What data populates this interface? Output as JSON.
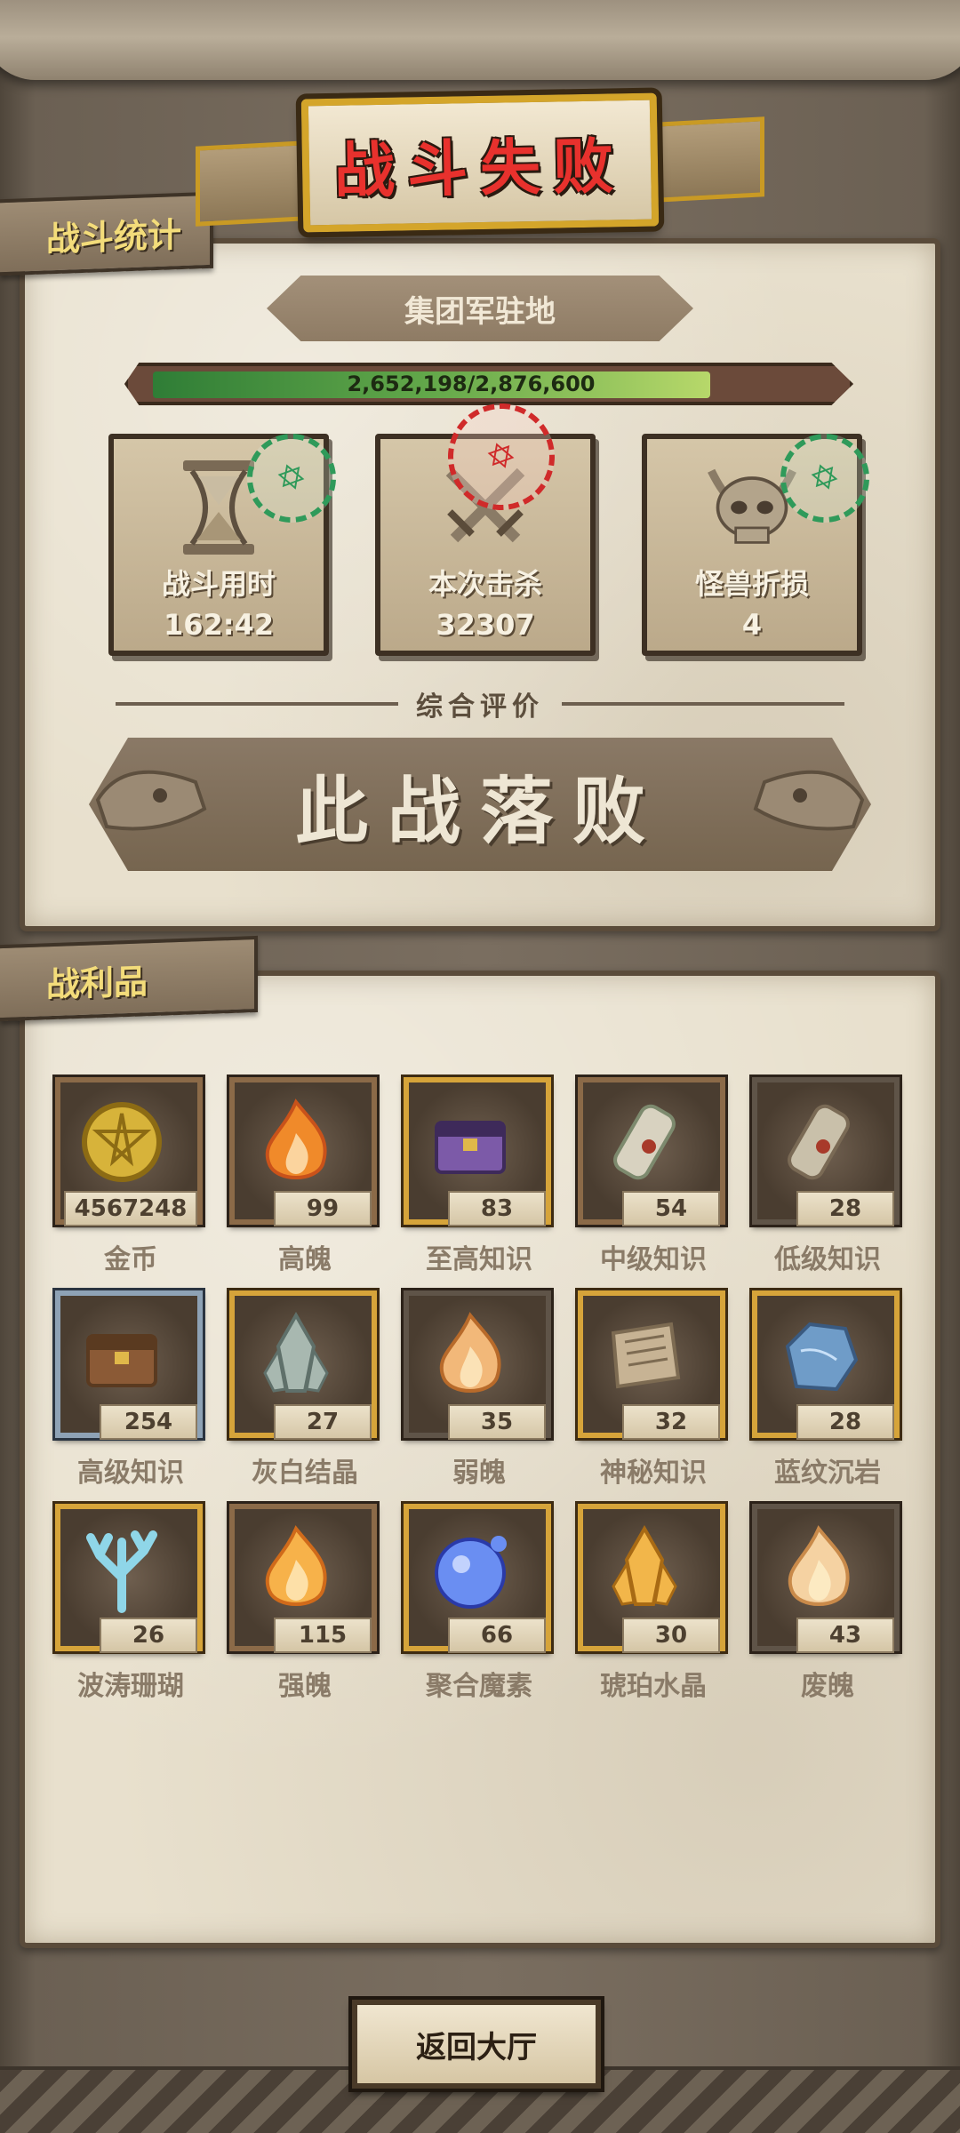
{
  "header": {
    "title": "战斗失败",
    "stats_tab": "战斗统计",
    "location": "集团军驻地"
  },
  "progress": {
    "current": 2652198,
    "max": 2876600,
    "text": "2,652,198/2,876,600",
    "fraction": 0.922
  },
  "stats": [
    {
      "label": "战斗用时",
      "value": "162:42",
      "icon": "hourglass-icon",
      "stamp": "hexagram-stamp",
      "stamp_color": "#2f9a5a"
    },
    {
      "label": "本次击杀",
      "value": "32307",
      "icon": "crossed-swords-icon",
      "stamp": "hexagram-stamp",
      "stamp_color": "#d02a2a"
    },
    {
      "label": "怪兽折损",
      "value": "4",
      "icon": "horned-skull-icon",
      "stamp": "hexagram-stamp",
      "stamp_color": "#2f9a5a"
    }
  ],
  "evaluation": {
    "label": "综合评价",
    "verdict": "此战落败"
  },
  "loot": {
    "tab": "战利品",
    "items": [
      {
        "name": "金币",
        "count": "4567248",
        "icon": "gold-coin-icon",
        "frame": "bronze"
      },
      {
        "name": "高魄",
        "count": "99",
        "icon": "orange-flame-icon",
        "frame": "bronze"
      },
      {
        "name": "至高知识",
        "count": "83",
        "icon": "purple-chest-icon",
        "frame": "gold"
      },
      {
        "name": "中级知识",
        "count": "54",
        "icon": "scroll-icon",
        "frame": "bronze"
      },
      {
        "name": "低级知识",
        "count": "28",
        "icon": "rolled-scroll-icon",
        "frame": "gray"
      },
      {
        "name": "高级知识",
        "count": "254",
        "icon": "tome-icon",
        "frame": "silver"
      },
      {
        "name": "灰白结晶",
        "count": "27",
        "icon": "gray-crystal-icon",
        "frame": "gold"
      },
      {
        "name": "弱魄",
        "count": "35",
        "icon": "small-flame-icon",
        "frame": "gray"
      },
      {
        "name": "神秘知识",
        "count": "32",
        "icon": "stone-tablet-icon",
        "frame": "gold"
      },
      {
        "name": "蓝纹沉岩",
        "count": "28",
        "icon": "blue-rock-icon",
        "frame": "gold"
      },
      {
        "name": "波涛珊瑚",
        "count": "26",
        "icon": "coral-icon",
        "frame": "gold"
      },
      {
        "name": "强魄",
        "count": "115",
        "icon": "strong-flame-icon",
        "frame": "bronze"
      },
      {
        "name": "聚合魔素",
        "count": "66",
        "icon": "mana-orb-icon",
        "frame": "gold"
      },
      {
        "name": "琥珀水晶",
        "count": "30",
        "icon": "amber-crystal-icon",
        "frame": "gold"
      },
      {
        "name": "废魄",
        "count": "43",
        "icon": "pale-flame-icon",
        "frame": "gray"
      }
    ]
  },
  "footer": {
    "return_label": "返回大厅"
  }
}
